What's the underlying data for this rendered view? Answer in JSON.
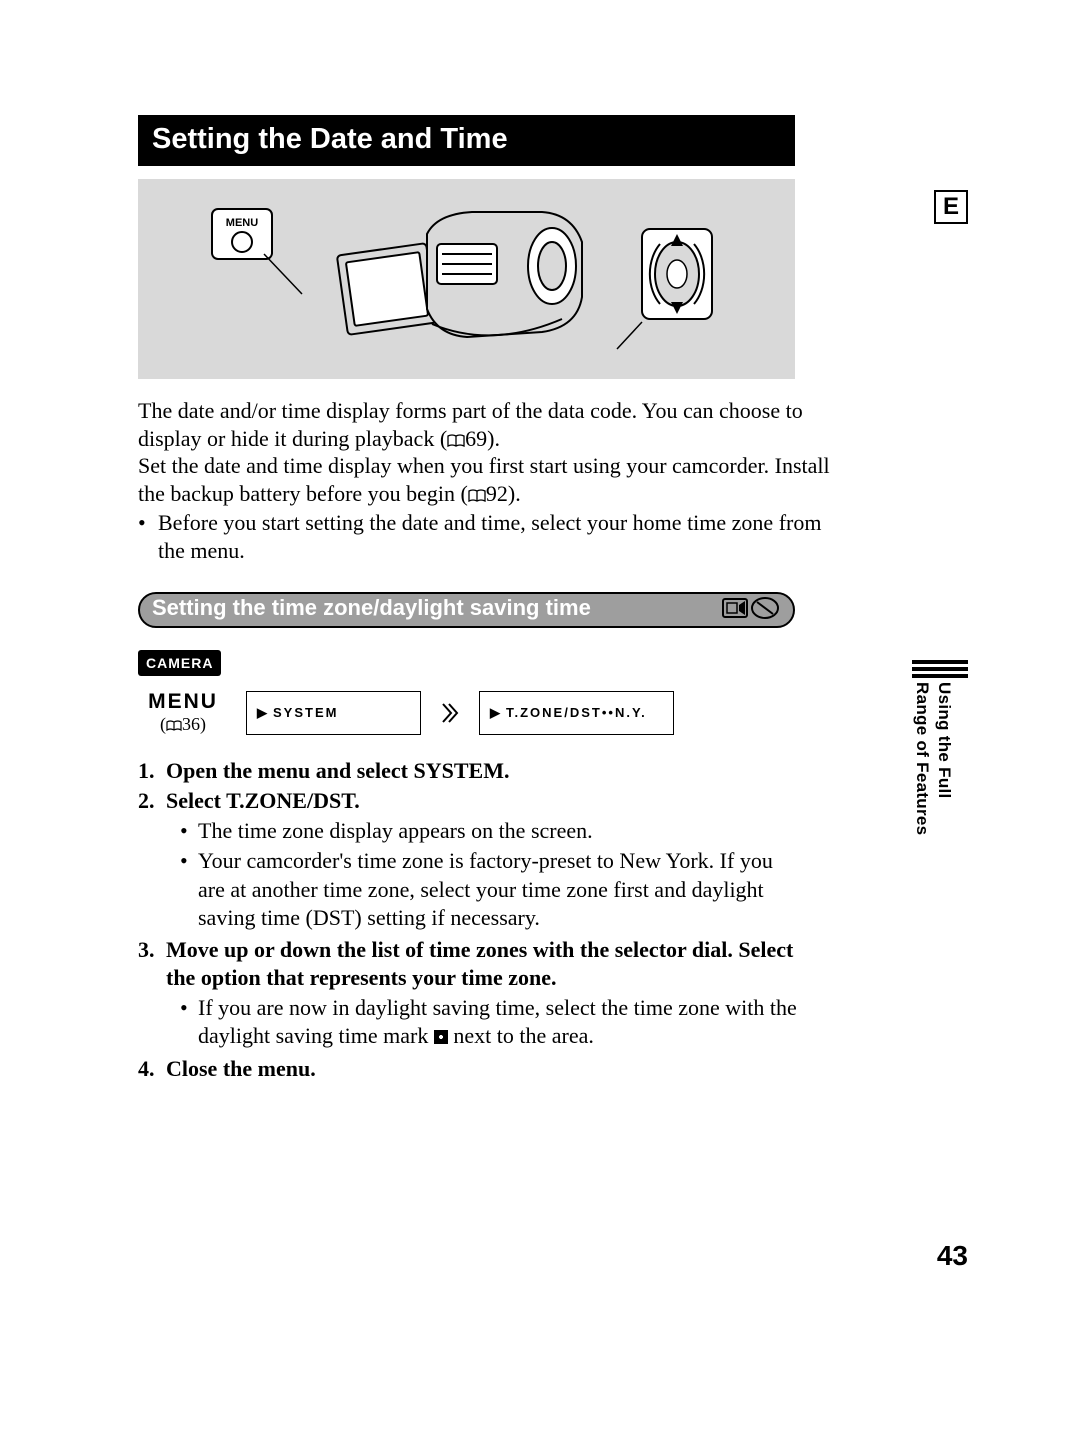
{
  "lang_badge": "E",
  "title": "Setting the Date and Time",
  "intro": {
    "p1a": "The date and/or time display forms part of the data code. You can choose to display or hide it during playback (",
    "p1b": "69).",
    "p2a": "Set the date and time display when you first start using your camcorder. Install the backup battery before you begin (",
    "p2b": "92).",
    "bullet": "Before you start setting the date and time, select your home time zone from the menu."
  },
  "subsection_title": "Setting the time zone/daylight saving time",
  "camera_badge": "CAMERA",
  "menu_label": "MENU",
  "menu_ref": "36",
  "menu_box1": "SYSTEM",
  "menu_box2": "T.ZONE/DST••N.Y.",
  "illus_menu_label": "MENU",
  "steps": {
    "s1_num": "1.",
    "s1": "Open the menu and select SYSTEM.",
    "s2_num": "2.",
    "s2": "Select T.ZONE/DST.",
    "s2b1": "The time zone display appears on the screen.",
    "s2b2": "Your camcorder's time zone is factory-preset to New York. If you are at another time zone, select your time zone first and daylight saving time (DST) setting if necessary.",
    "s3_num": "3.",
    "s3": "Move up or down the list of time zones with the selector dial. Select the option that represents your time zone.",
    "s3b1a": "If you are now in daylight saving time, select the time zone with the daylight saving time mark ",
    "s3b1b": " next to the area.",
    "s4_num": "4.",
    "s4": "Close the menu."
  },
  "side_tab_line1": "Using the Full",
  "side_tab_line2": "Range of Features",
  "page_number": "43"
}
